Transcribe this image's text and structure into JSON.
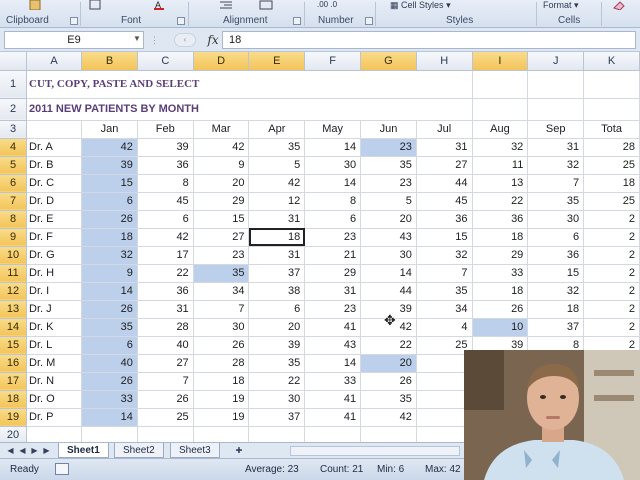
{
  "ribbon": {
    "groups": [
      {
        "label": "Clipboard"
      },
      {
        "label": "Font"
      },
      {
        "label": "Alignment"
      },
      {
        "label": "Number"
      },
      {
        "label": "Styles"
      },
      {
        "label": "Cells"
      }
    ],
    "cell_styles_label": "Cell Styles",
    "format_label": "Format"
  },
  "formula_bar": {
    "name_box": "E9",
    "fx": "fx",
    "formula": "18"
  },
  "columns": [
    "A",
    "B",
    "C",
    "D",
    "E",
    "F",
    "G",
    "H",
    "I",
    "J",
    "K"
  ],
  "selected_columns": [
    "B",
    "D",
    "E",
    "G",
    "I"
  ],
  "rows": [
    "1",
    "2",
    "3",
    "4",
    "5",
    "6",
    "7",
    "8",
    "9",
    "10",
    "11",
    "12",
    "13",
    "14",
    "15",
    "16",
    "17",
    "18",
    "19",
    "20"
  ],
  "selected_rows": [
    "4",
    "5",
    "6",
    "7",
    "8",
    "9",
    "10",
    "11",
    "12",
    "13",
    "14",
    "15",
    "16",
    "17",
    "18",
    "19"
  ],
  "sheet": {
    "title": "CUT, COPY, PASTE AND SELECT",
    "subtitle": "2011 NEW PATIENTS BY MONTH",
    "months": [
      "Jan",
      "Feb",
      "Mar",
      "Apr",
      "May",
      "Jun",
      "Jul",
      "Aug",
      "Sep",
      "Tota"
    ],
    "data": [
      {
        "name": "Dr. A",
        "values": [
          "42",
          "39",
          "42",
          "35",
          "14",
          "23",
          "31",
          "32",
          "31",
          "28"
        ]
      },
      {
        "name": "Dr. B",
        "values": [
          "39",
          "36",
          "9",
          "5",
          "30",
          "35",
          "27",
          "11",
          "32",
          "25"
        ]
      },
      {
        "name": "Dr. C",
        "values": [
          "15",
          "8",
          "20",
          "42",
          "14",
          "23",
          "44",
          "13",
          "7",
          "18"
        ]
      },
      {
        "name": "Dr. D",
        "values": [
          "6",
          "45",
          "29",
          "12",
          "8",
          "5",
          "45",
          "22",
          "35",
          "25"
        ]
      },
      {
        "name": "Dr. E",
        "values": [
          "26",
          "6",
          "15",
          "31",
          "6",
          "20",
          "36",
          "36",
          "30",
          "2"
        ]
      },
      {
        "name": "Dr. F",
        "values": [
          "18",
          "42",
          "27",
          "18",
          "23",
          "43",
          "15",
          "18",
          "6",
          "2"
        ]
      },
      {
        "name": "Dr. G",
        "values": [
          "32",
          "17",
          "23",
          "31",
          "21",
          "30",
          "32",
          "29",
          "36",
          "2"
        ]
      },
      {
        "name": "Dr. H",
        "values": [
          "9",
          "22",
          "35",
          "37",
          "29",
          "14",
          "7",
          "33",
          "15",
          "2"
        ]
      },
      {
        "name": "Dr. I",
        "values": [
          "14",
          "36",
          "34",
          "38",
          "31",
          "44",
          "35",
          "18",
          "32",
          "2"
        ]
      },
      {
        "name": "Dr. J",
        "values": [
          "26",
          "31",
          "7",
          "6",
          "23",
          "39",
          "34",
          "26",
          "18",
          "2"
        ]
      },
      {
        "name": "Dr. K",
        "values": [
          "35",
          "28",
          "30",
          "20",
          "41",
          "42",
          "4",
          "10",
          "37",
          "2"
        ]
      },
      {
        "name": "Dr. L",
        "values": [
          "6",
          "40",
          "26",
          "39",
          "43",
          "22",
          "25",
          "39",
          "8",
          "2"
        ]
      },
      {
        "name": "Dr. M",
        "values": [
          "40",
          "27",
          "28",
          "35",
          "14",
          "20",
          "",
          "",
          "",
          ""
        ]
      },
      {
        "name": "Dr. N",
        "values": [
          "26",
          "7",
          "18",
          "22",
          "33",
          "26",
          "",
          "",
          "",
          ""
        ]
      },
      {
        "name": "Dr. O",
        "values": [
          "33",
          "26",
          "19",
          "30",
          "41",
          "35",
          "",
          "",
          "",
          ""
        ]
      },
      {
        "name": "Dr. P",
        "values": [
          "14",
          "25",
          "19",
          "37",
          "41",
          "42",
          "",
          "",
          "",
          ""
        ]
      }
    ]
  },
  "tabs": [
    "Sheet1",
    "Sheet2",
    "Sheet3"
  ],
  "status": {
    "mode": "Ready",
    "average": "Average: 23",
    "count": "Count: 21",
    "min": "Min: 6",
    "max": "Max: 42"
  }
}
